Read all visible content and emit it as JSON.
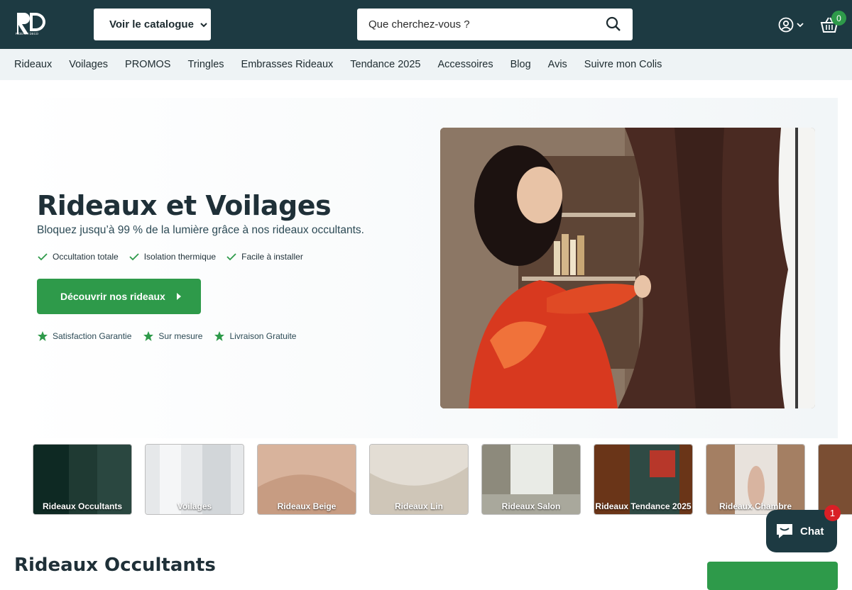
{
  "header": {
    "logo_text": "RIDEAUX DECO",
    "catalog_label": "Voir le catalogue",
    "search_placeholder": "Que cherchez-vous ?",
    "cart_count": "0"
  },
  "nav": {
    "items": [
      "Rideaux",
      "Voilages",
      "PROMOS",
      "Tringles",
      "Embrasses Rideaux",
      "Tendance 2025",
      "Accessoires",
      "Blog",
      "Avis",
      "Suivre mon Colis"
    ]
  },
  "hero": {
    "title": "Rideaux et Voilages",
    "subtitle": "Bloquez jusqu’à 99 % de la lumière grâce à nos rideaux occultants.",
    "features": [
      "Occultation totale",
      "Isolation thermique",
      "Facile à installer"
    ],
    "cta_label": "Découvrir nos rideaux",
    "assurances": [
      "Satisfaction Garantie",
      "Sur mesure",
      "Livraison Gratuite"
    ]
  },
  "categories": [
    {
      "label": "Rideaux Occultants",
      "color": "#1f3a33"
    },
    {
      "label": "Voilages",
      "color": "#e6e8ea"
    },
    {
      "label": "Rideaux Beige",
      "color": "#d8b39c"
    },
    {
      "label": "Rideaux Lin",
      "color": "#e3ddd4"
    },
    {
      "label": "Rideaux Salon",
      "color": "#8d8a7c"
    },
    {
      "label": "Rideaux Tendance 2025",
      "color": "#6a3518"
    },
    {
      "label": "Rideaux Chambre",
      "color": "#a47f63"
    },
    {
      "label": "",
      "color": "#7a4e33"
    }
  ],
  "section": {
    "title": "Rideaux Occultants"
  },
  "chat": {
    "label": "Chat",
    "badge": "1"
  },
  "colors": {
    "header_bg": "#1d3a42",
    "accent_green": "#2e9a4a",
    "nav_bg": "#eef3f5",
    "chat_badge": "#d91f26"
  }
}
